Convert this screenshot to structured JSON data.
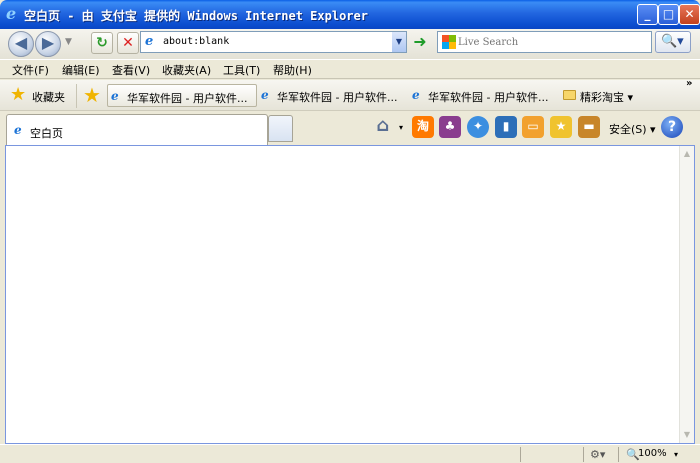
{
  "window": {
    "title": "空白页 - 由 支付宝 提供的 Windows Internet Explorer",
    "minimize": "_",
    "maximize": "□",
    "close": "✕"
  },
  "nav": {
    "back": "◀",
    "forward": "▶",
    "history_drop": "▼",
    "refresh": "↻",
    "stop": "✕",
    "go": "➜"
  },
  "address": {
    "url": "about:blank",
    "drop": "▼"
  },
  "search": {
    "placeholder": "Live Search",
    "button": "🔍▾"
  },
  "menu": {
    "items": [
      "文件(F)",
      "编辑(E)",
      "查看(V)",
      "收藏夹(A)",
      "工具(T)",
      "帮助(H)"
    ]
  },
  "favorites": {
    "label": "收藏夹",
    "links": [
      "华军软件园 - 用户软件...",
      "华军软件园 - 用户软件...",
      "华军软件园 - 用户软件..."
    ],
    "folder": "精彩淘宝 ▾",
    "more": "»"
  },
  "tabs": {
    "active_label": "空白页"
  },
  "toolbar": {
    "home_drop": "▾",
    "icons": [
      "淘",
      "♣",
      "✦",
      "▮",
      "▭",
      "★",
      "▬"
    ],
    "safety": "安全(S) ▾",
    "help": "?"
  },
  "status": {
    "zoom": "100%",
    "zoom_drop": "▾"
  },
  "colors": {
    "titlebar": "#2266e0",
    "taobao": "#ff7a00",
    "accent_blue": "#1c73d6"
  }
}
